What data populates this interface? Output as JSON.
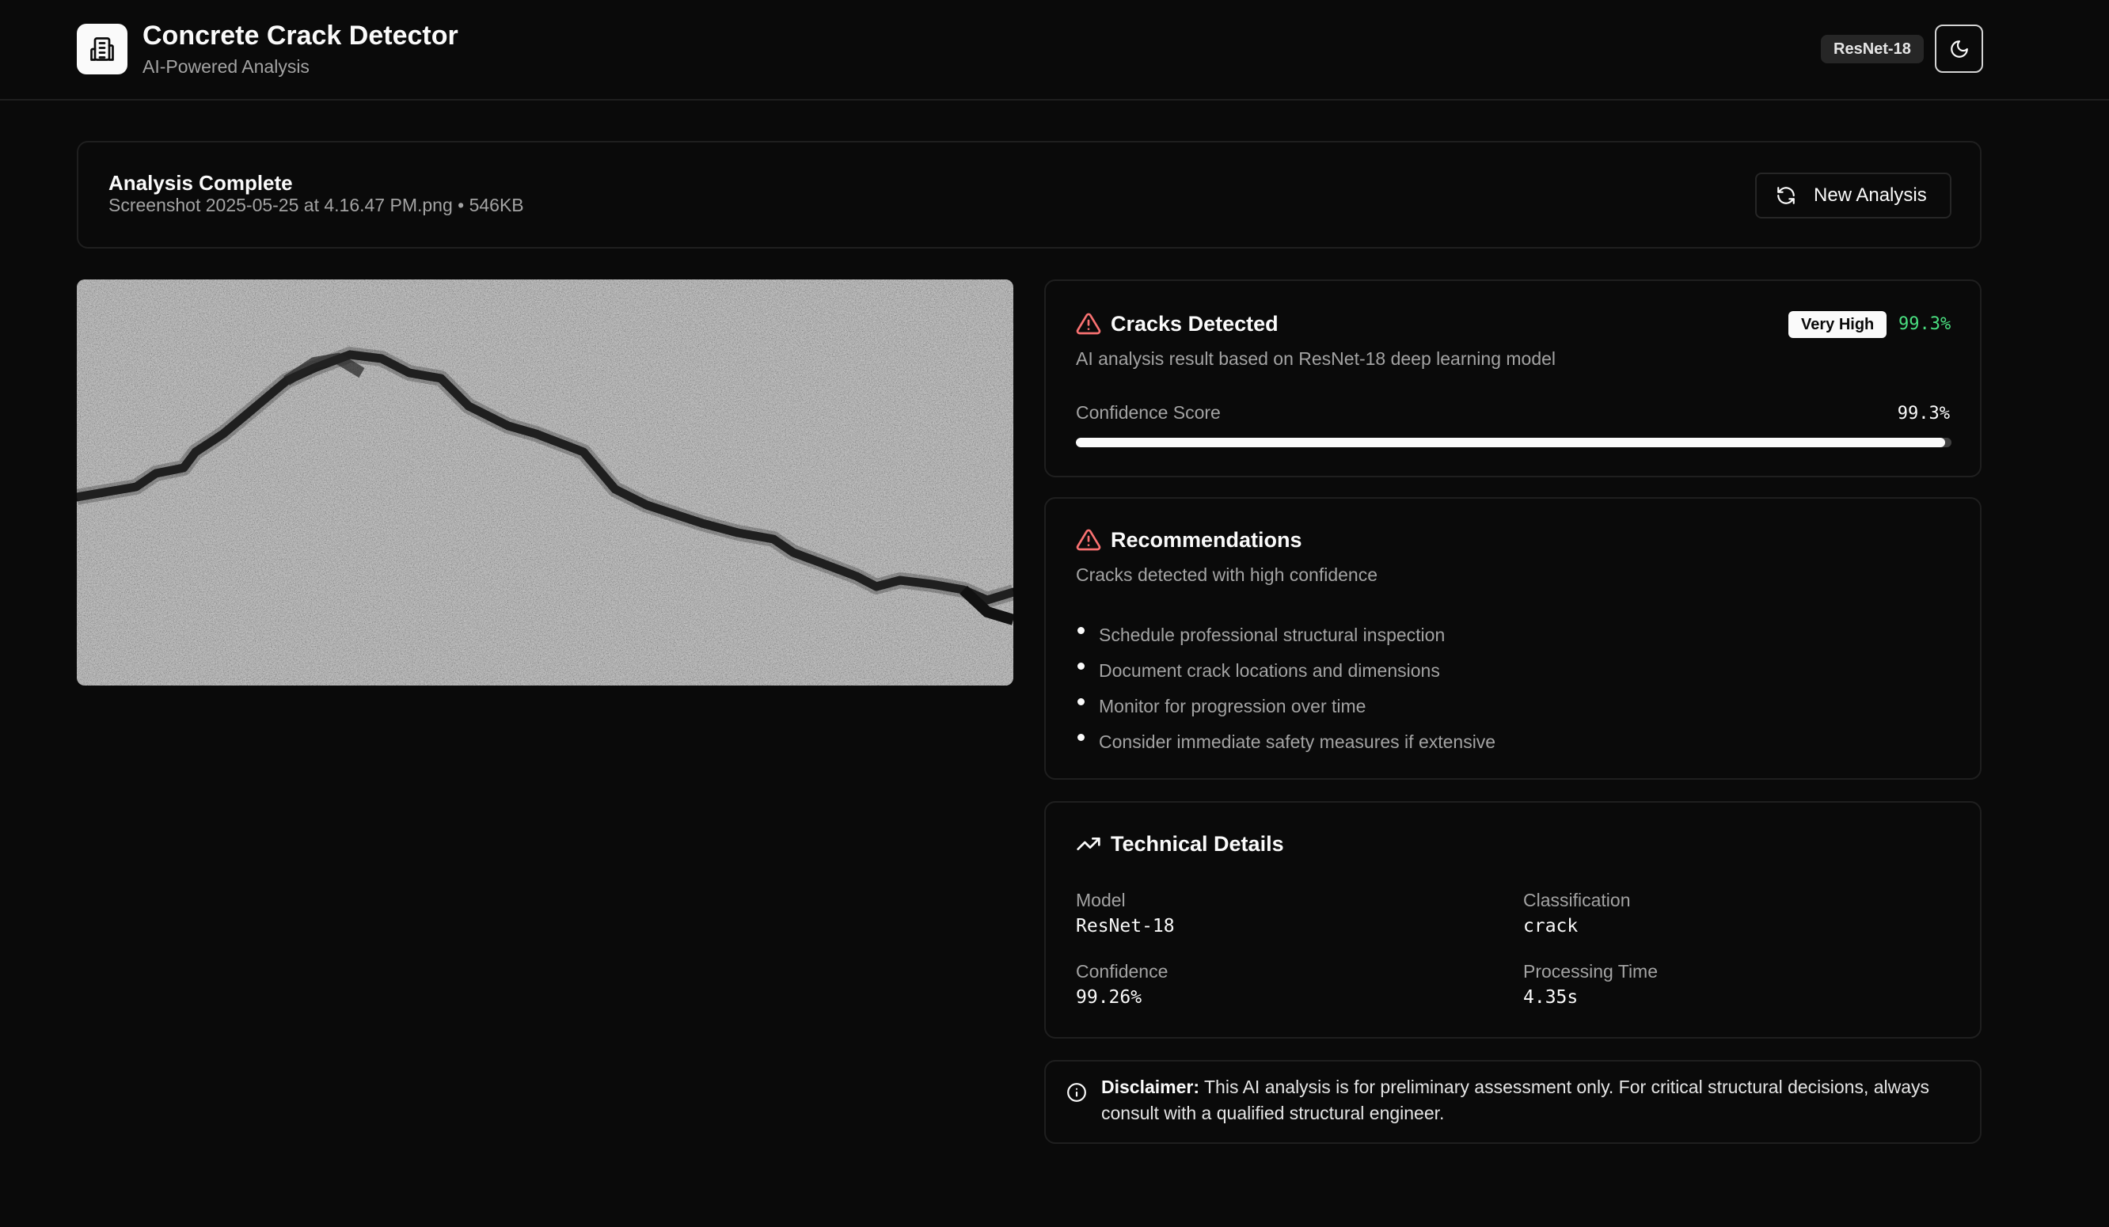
{
  "header": {
    "title": "Concrete Crack Detector",
    "subtitle": "AI-Powered Analysis",
    "model_badge": "ResNet-18",
    "logo_icon": "building-icon",
    "theme_icon": "moon-icon"
  },
  "status": {
    "title": "Analysis Complete",
    "file_name": "Screenshot 2025-05-25 at 4.16.47 PM.png",
    "separator": "•",
    "file_size": "546KB",
    "new_analysis_label": "New Analysis",
    "new_analysis_icon": "refresh-icon"
  },
  "detection": {
    "title": "Cracks Detected",
    "icon": "warning-triangle-icon",
    "level_badge": "Very High",
    "percent": "99.3%",
    "description": "AI analysis result based on ResNet-18 deep learning model",
    "confidence_label": "Confidence Score",
    "confidence_value": "99.3%",
    "confidence_fraction": 0.993
  },
  "recommendations": {
    "title": "Recommendations",
    "icon": "warning-triangle-icon",
    "description": "Cracks detected with high confidence",
    "items": [
      "Schedule professional structural inspection",
      "Document crack locations and dimensions",
      "Monitor for progression over time",
      "Consider immediate safety measures if extensive"
    ]
  },
  "technical": {
    "title": "Technical Details",
    "icon": "trending-up-icon",
    "model_label": "Model",
    "model_value": "ResNet-18",
    "classification_label": "Classification",
    "classification_value": "crack",
    "confidence_label": "Confidence",
    "confidence_value": "99.26%",
    "time_label": "Processing Time",
    "time_value": "4.35s"
  },
  "disclaimer": {
    "label": "Disclaimer:",
    "text": "This AI analysis is for preliminary assessment only. For critical structural decisions, always consult with a qualified structural engineer.",
    "icon": "info-icon"
  },
  "colors": {
    "background": "#0a0a0a",
    "warning": "#f87171",
    "success": "#4ade80",
    "border": "#1f1f1f"
  }
}
